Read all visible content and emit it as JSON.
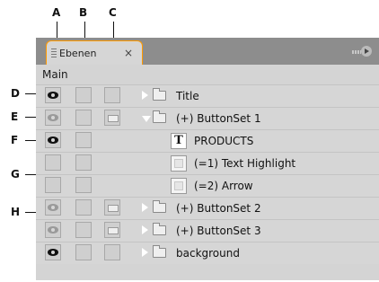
{
  "callouts": {
    "A": "A",
    "B": "B",
    "C": "C",
    "D": "D",
    "E": "E",
    "F": "F",
    "G": "G",
    "H": "H"
  },
  "panel": {
    "tab_label": "Ebenen",
    "tab_close": "×",
    "breadcrumb": "Main",
    "menu_icon": "panel-menu-icon"
  },
  "layers": [
    {
      "name": "Title",
      "type": "folder",
      "expanded": false,
      "eye": "dark",
      "state": false
    },
    {
      "name": "(+) ButtonSet 1",
      "type": "folder",
      "expanded": true,
      "eye": "dim",
      "state": true
    },
    {
      "name": "PRODUCTS",
      "type": "text",
      "eye": "dark",
      "state": false
    },
    {
      "name": "(=1) Text Highlight",
      "type": "image",
      "eye": "none",
      "state": false
    },
    {
      "name": "(=2) Arrow",
      "type": "image",
      "eye": "none",
      "state": false
    },
    {
      "name": "(+) ButtonSet 2",
      "type": "folder",
      "expanded": false,
      "eye": "dim",
      "state": true
    },
    {
      "name": "(+) ButtonSet 3",
      "type": "folder",
      "expanded": false,
      "eye": "dim",
      "state": true
    },
    {
      "name": "background",
      "type": "folder",
      "expanded": false,
      "eye": "dark",
      "state": false
    }
  ],
  "colors": {
    "tab_border": "#ff9a00",
    "panel_bg": "#d4d4d4",
    "topbar_bg": "#8d8d8d"
  }
}
